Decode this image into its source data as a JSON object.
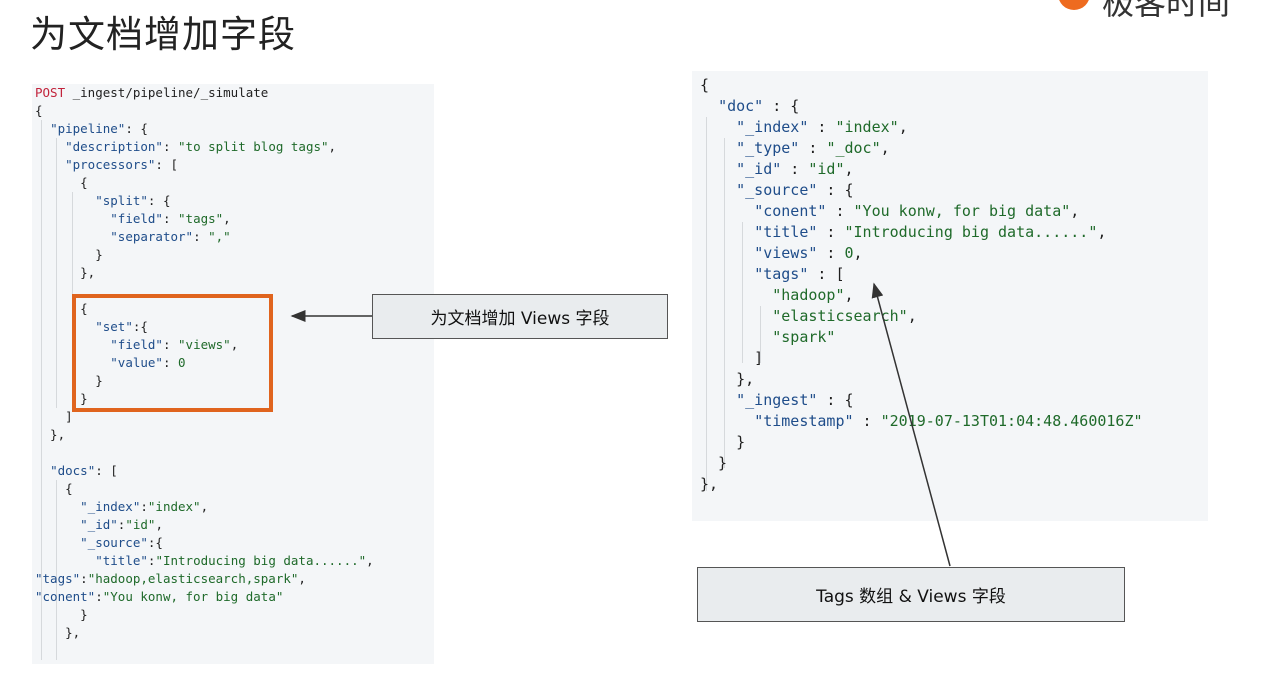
{
  "slide": {
    "title": "为文档增加字段"
  },
  "logo": {
    "text": "极客时间",
    "color": "#ee6b1f"
  },
  "left_code": {
    "lines": [
      "POST _ingest/pipeline/_simulate",
      "{",
      "  \"pipeline\": {",
      "    \"description\": \"to split blog tags\",",
      "    \"processors\": [",
      "      {",
      "        \"split\": {",
      "          \"field\": \"tags\",",
      "          \"separator\": \",\"",
      "        }",
      "      },",
      "",
      "      {",
      "        \"set\":{",
      "          \"field\": \"views\",",
      "          \"value\": 0",
      "        }",
      "      }",
      "    ]",
      "  },",
      "",
      "  \"docs\": [",
      "    {",
      "      \"_index\":\"index\",",
      "      \"_id\":\"id\",",
      "      \"_source\":{",
      "        \"title\":\"Introducing big data......\",",
      "\"tags\":\"hadoop,elasticsearch,spark\",",
      "\"conent\":\"You konw, for big data\"",
      "      }",
      "    },",
      "",
      ""
    ]
  },
  "right_code": {
    "lines": [
      "{",
      "  \"doc\" : {",
      "    \"_index\" : \"index\",",
      "    \"_type\" : \"_doc\",",
      "    \"_id\" : \"id\",",
      "    \"_source\" : {",
      "      \"conent\" : \"You konw, for big data\",",
      "      \"title\" : \"Introducing big data......\",",
      "      \"views\" : 0,",
      "      \"tags\" : [",
      "        \"hadoop\",",
      "        \"elasticsearch\",",
      "        \"spark\"",
      "      ]",
      "    },",
      "    \"_ingest\" : {",
      "      \"timestamp\" : \"2019-07-13T01:04:48.460016Z\"",
      "    }",
      "  }",
      "},"
    ]
  },
  "callouts": {
    "views_field": "为文档增加 Views 字段",
    "tags_views": "Tags 数组 & Views 字段"
  },
  "colors": {
    "highlight": "#e0641e",
    "panel_bg": "#f4f6f8",
    "method": "#c2233b"
  }
}
